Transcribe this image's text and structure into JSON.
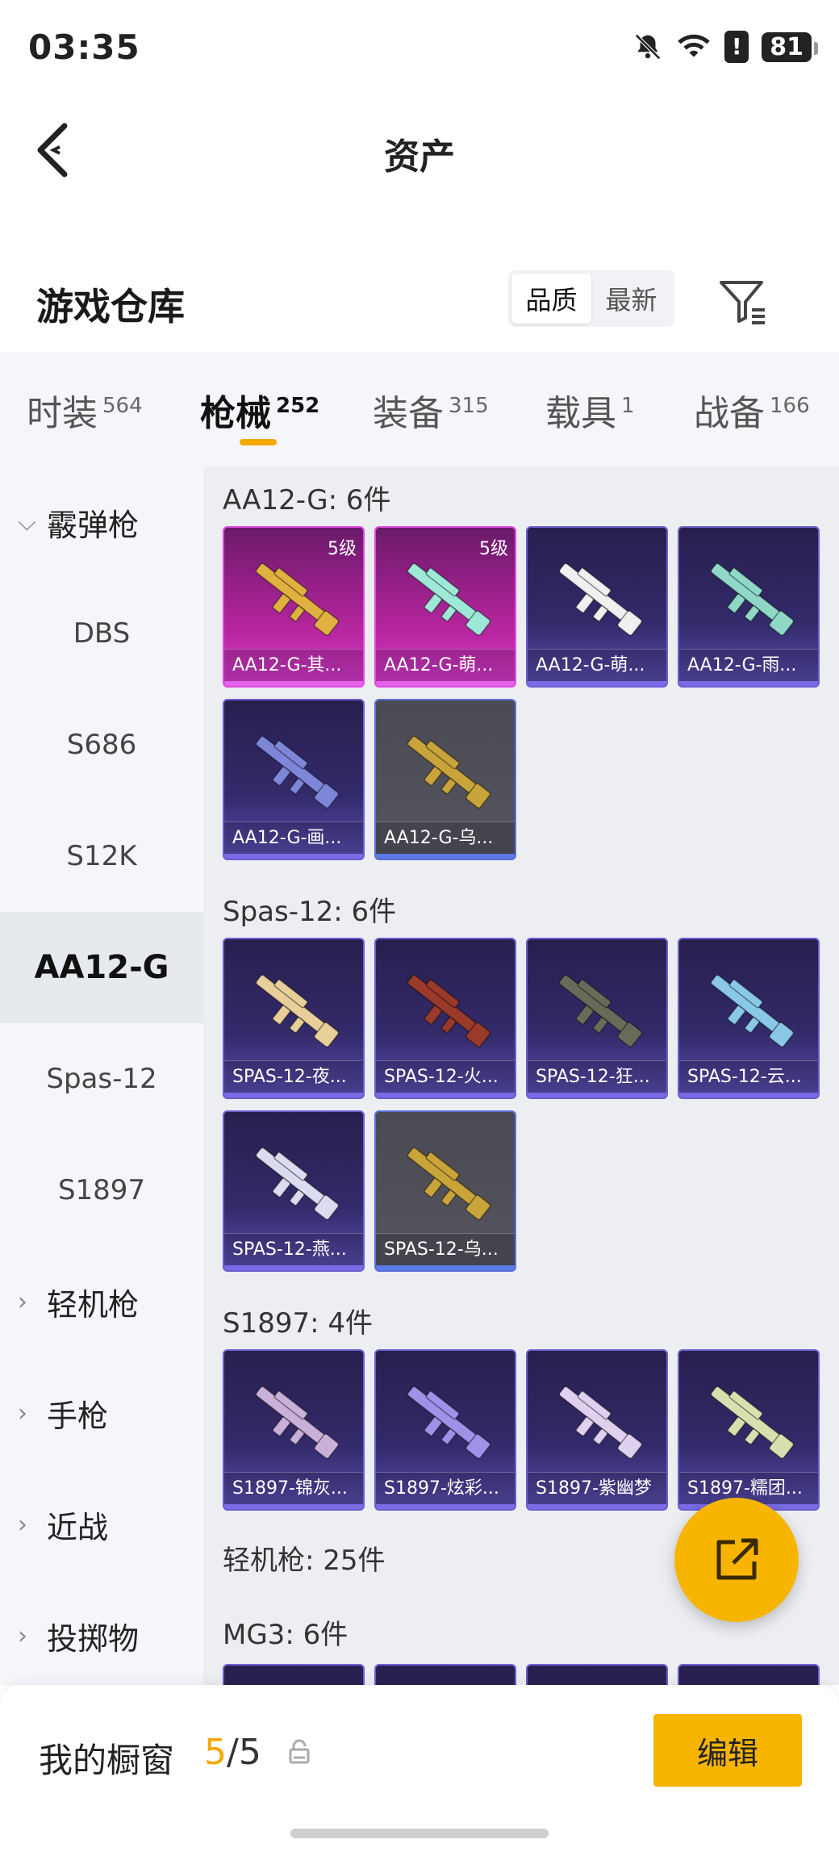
{
  "status_bar": {
    "time": "03:35",
    "battery": "81"
  },
  "header": {
    "title": "资产"
  },
  "section": {
    "heading": "游戏仓库",
    "sort_options": [
      "品质",
      "最新"
    ],
    "sort_selected": "品质"
  },
  "tabs": [
    {
      "label": "时装",
      "count": "564"
    },
    {
      "label": "枪械",
      "count": "252"
    },
    {
      "label": "装备",
      "count": "315"
    },
    {
      "label": "载具",
      "count": "1"
    },
    {
      "label": "战备",
      "count": "166"
    }
  ],
  "sidebar": {
    "items": [
      {
        "label": "霰弹枪",
        "type": "group"
      },
      {
        "label": "DBS",
        "type": "sub"
      },
      {
        "label": "S686",
        "type": "sub"
      },
      {
        "label": "S12K",
        "type": "sub"
      },
      {
        "label": "AA12-G",
        "type": "sub-active"
      },
      {
        "label": "Spas-12",
        "type": "sub"
      },
      {
        "label": "S1897",
        "type": "sub"
      },
      {
        "label": "轻机枪",
        "type": "group"
      },
      {
        "label": "手枪",
        "type": "group"
      },
      {
        "label": "近战",
        "type": "group"
      },
      {
        "label": "投掷物",
        "type": "group"
      }
    ]
  },
  "groups": [
    {
      "title": "AA12-G: 6件",
      "cards": [
        {
          "name": "AA12-G-其...",
          "level": "5级",
          "rarity": "pink",
          "color": "#e0b040"
        },
        {
          "name": "AA12-G-萌...",
          "level": "5级",
          "rarity": "pink",
          "color": "#9ee8d8"
        },
        {
          "name": "AA12-G-萌...",
          "level": "",
          "rarity": "purple",
          "color": "#f0f0f0"
        },
        {
          "name": "AA12-G-雨...",
          "level": "",
          "rarity": "purple",
          "color": "#8fd8c8"
        },
        {
          "name": "AA12-G-画...",
          "level": "",
          "rarity": "purple",
          "color": "#7d86d8"
        },
        {
          "name": "AA12-G-乌...",
          "level": "",
          "rarity": "grey",
          "color": "#c9a43a"
        }
      ]
    },
    {
      "title": "Spas-12: 6件",
      "cards": [
        {
          "name": "SPAS-12-夜...",
          "level": "",
          "rarity": "purple",
          "color": "#e8cf9a"
        },
        {
          "name": "SPAS-12-火...",
          "level": "",
          "rarity": "purple",
          "color": "#9a3a2a"
        },
        {
          "name": "SPAS-12-狂...",
          "level": "",
          "rarity": "purple",
          "color": "#6a6a5a"
        },
        {
          "name": "SPAS-12-云...",
          "level": "",
          "rarity": "purple",
          "color": "#8ac8e8"
        },
        {
          "name": "SPAS-12-燕...",
          "level": "",
          "rarity": "purple",
          "color": "#dcdcf0"
        },
        {
          "name": "SPAS-12-乌...",
          "level": "",
          "rarity": "grey",
          "color": "#c9a43a"
        }
      ]
    },
    {
      "title": "S1897: 4件",
      "cards": [
        {
          "name": "S1897-锦灰...",
          "level": "",
          "rarity": "purple",
          "color": "#c8b0d8"
        },
        {
          "name": "S1897-炫彩...",
          "level": "",
          "rarity": "purple",
          "color": "#a090e8"
        },
        {
          "name": "S1897-紫幽梦",
          "level": "",
          "rarity": "purple",
          "color": "#e0d0f0"
        },
        {
          "name": "S1897-糯团...",
          "level": "",
          "rarity": "purple",
          "color": "#d8e0b0"
        }
      ]
    },
    {
      "title": "轻机枪: 25件",
      "cards": []
    },
    {
      "title": "MG3: 6件",
      "cards": [
        {
          "name": "",
          "level": "",
          "rarity": "purple",
          "color": "#888"
        },
        {
          "name": "",
          "level": "",
          "rarity": "purple",
          "color": "#888"
        },
        {
          "name": "",
          "level": "",
          "rarity": "purple",
          "color": "#888"
        },
        {
          "name": "",
          "level": "",
          "rarity": "purple",
          "color": "#888"
        }
      ]
    }
  ],
  "bottom_bar": {
    "label": "我的橱窗",
    "current": "5",
    "separator": "/",
    "max": "5",
    "edit_label": "编辑"
  },
  "colors": {
    "accent": "#f7b500",
    "tab_indicator": "#f5a800"
  }
}
